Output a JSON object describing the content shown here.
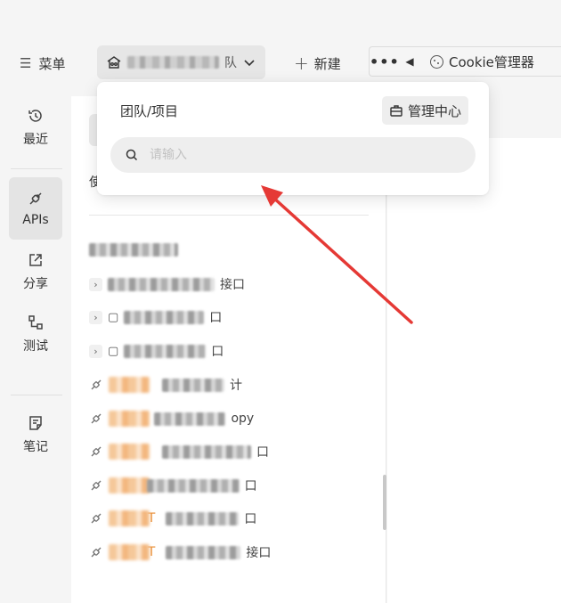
{
  "toolbar": {
    "menu_label": "菜单",
    "team_suffix": "队",
    "new_label": "新建",
    "more_label": "•••",
    "cookie_label": "Cookie管理器"
  },
  "sidebar": {
    "items": [
      {
        "label": "最近",
        "icon": "history-icon"
      },
      {
        "label": "APIs",
        "icon": "plug-icon"
      },
      {
        "label": "分享",
        "icon": "share-icon"
      },
      {
        "label": "测试",
        "icon": "flow-icon"
      },
      {
        "label": "笔记",
        "icon": "note-icon"
      }
    ],
    "active": "APIs"
  },
  "dropdown": {
    "title": "团队/项目",
    "admin_label": "管理中心",
    "search_placeholder": "请输入"
  },
  "api_list": {
    "header_stub": "使",
    "folders": [
      {
        "tail": "接口"
      },
      {
        "tail": "口"
      },
      {
        "tail": "口"
      }
    ],
    "items": [
      {
        "method": "",
        "tail": "计"
      },
      {
        "method": "ST",
        "tail": "opy"
      },
      {
        "method": "",
        "tail": "口"
      },
      {
        "method": "T",
        "tail": "口"
      },
      {
        "method": "P  ST",
        "tail": "口"
      },
      {
        "method": "P  ST",
        "tail": "接口"
      }
    ]
  },
  "colors": {
    "accent_post": "#e8892e",
    "annotation_arrow": "#e53935"
  }
}
